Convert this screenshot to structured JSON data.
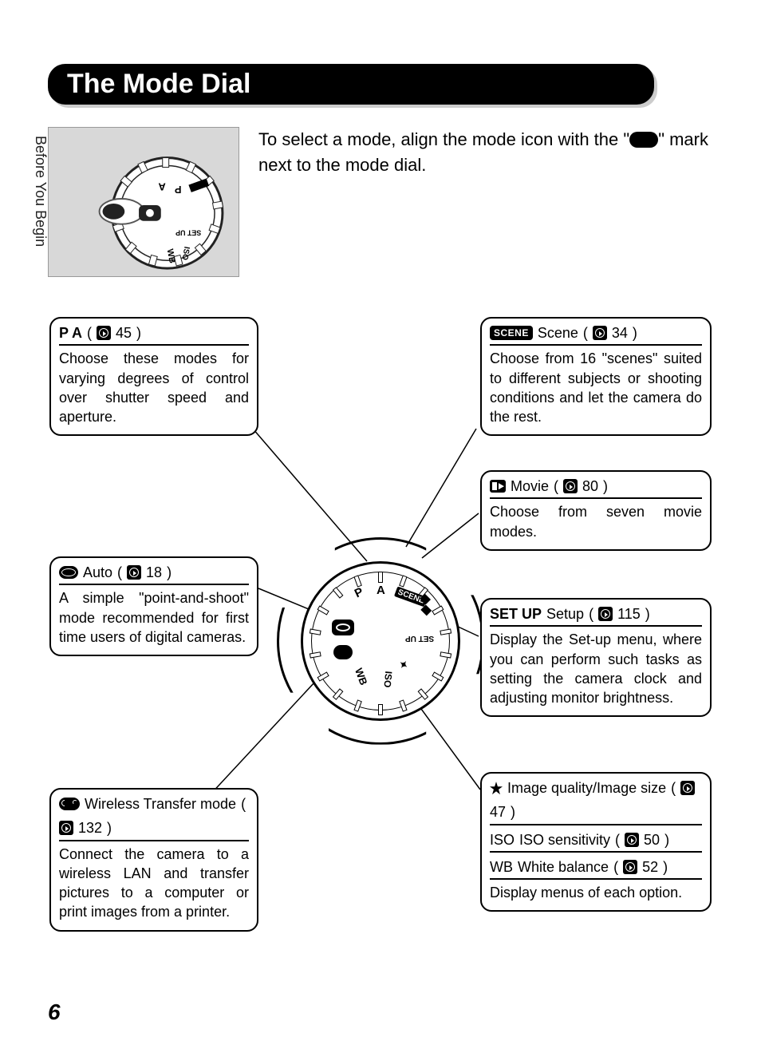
{
  "section": "Before You Begin",
  "title": "The Mode Dial",
  "intro_before": "To select a mode, align the mode icon with the \"",
  "intro_after": "\" mark next to the mode dial.",
  "page_number": "6",
  "callouts": {
    "pa": {
      "label_bold": "P A",
      "page": "45",
      "body": "Choose these modes for varying degrees of control over shutter speed and aperture."
    },
    "scene": {
      "chip": "SCENE",
      "label": "Scene",
      "page": "34",
      "body": "Choose from 16 \"scenes\" suited to different subjects or shooting conditions and let the camera do the rest."
    },
    "movie": {
      "label": "Movie",
      "page": "80",
      "body": "Choose from seven movie modes."
    },
    "auto": {
      "label": "Auto",
      "page": "18",
      "body": "A simple \"point-and-shoot\" mode recommended for first time users of digital cameras."
    },
    "setup": {
      "chip": "SET UP",
      "label": "Setup",
      "page": "115",
      "body": "Display the Set-up menu, where you can perform such tasks as setting the camera clock and adjusting monitor brightness."
    },
    "wifi": {
      "label": "Wireless Transfer mode",
      "page": "132",
      "body": "Connect the camera to a wireless LAN and transfer pictures to a computer or print images from a printer."
    },
    "quality": {
      "h1_label": "Image quality/Image size",
      "h1_page": "47",
      "h2_bold": "ISO",
      "h2_label": "ISO sensitivity",
      "h2_page": "50",
      "h3_bold": "WB",
      "h3_label": "White balance",
      "h3_page": "52",
      "body": "Display menus of each option."
    }
  },
  "dial": {
    "labels": [
      "P",
      "A",
      "SCENE",
      "SET UP",
      "ISO",
      "WB"
    ]
  }
}
